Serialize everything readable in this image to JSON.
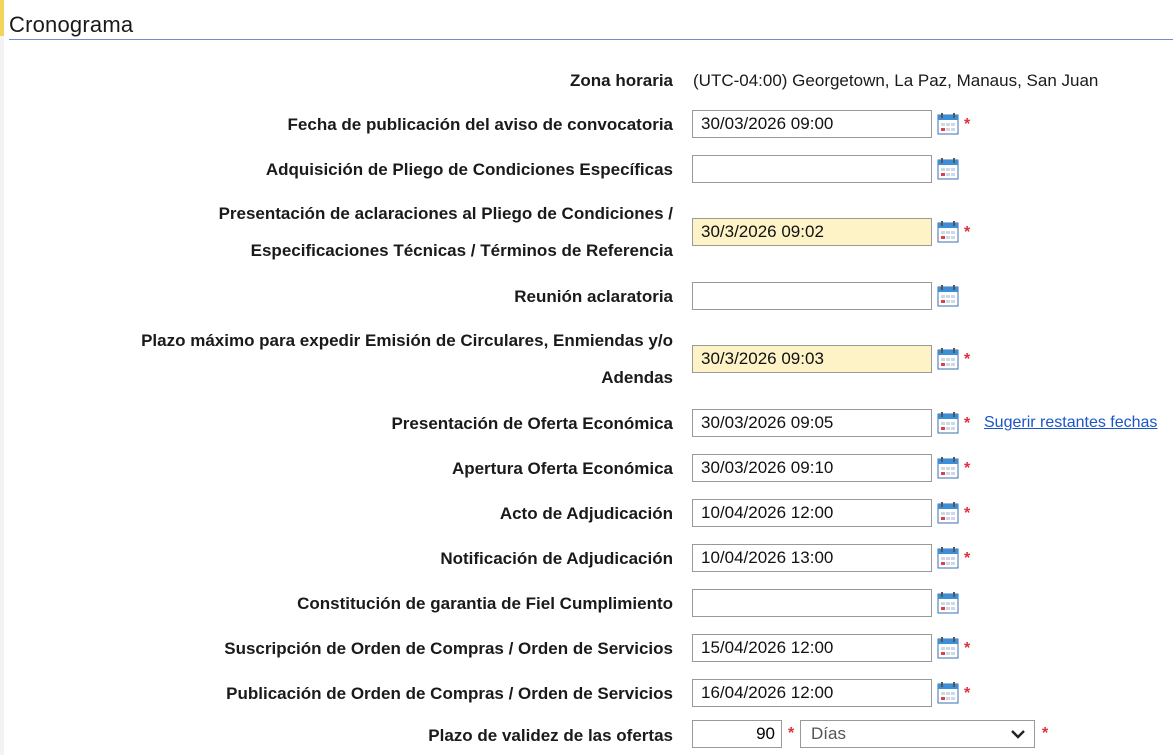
{
  "section": {
    "title": "Cronograma"
  },
  "timezone": {
    "label": "Zona horaria",
    "value": "(UTC-04:00) Georgetown, La Paz, Manaus, San Juan"
  },
  "fields": [
    {
      "label_lines": [
        "Fecha de publicación del aviso de convocatoria"
      ],
      "value": "30/03/2026 09:00",
      "required": true,
      "highlight": false
    },
    {
      "label_lines": [
        "Adquisición de Pliego de Condiciones Específicas"
      ],
      "value": "",
      "required": false,
      "highlight": false
    },
    {
      "label_lines": [
        "Presentación de aclaraciones al Pliego de Condiciones /",
        "Especificaciones Técnicas / Términos de Referencia"
      ],
      "value": "30/3/2026 09:02",
      "required": true,
      "highlight": true
    },
    {
      "label_lines": [
        "Reunión aclaratoria"
      ],
      "value": "",
      "required": false,
      "highlight": false
    },
    {
      "label_lines": [
        "Plazo máximo para expedir Emisión de Circulares, Enmiendas y/o",
        "Adendas"
      ],
      "value": "30/3/2026 09:03",
      "required": true,
      "highlight": true
    },
    {
      "label_lines": [
        "Presentación de Oferta Económica"
      ],
      "value": "30/03/2026 09:05",
      "required": true,
      "highlight": false,
      "link": "Sugerir restantes fechas"
    },
    {
      "label_lines": [
        "Apertura Oferta Económica"
      ],
      "value": "30/03/2026 09:10",
      "required": true,
      "highlight": false
    },
    {
      "label_lines": [
        "Acto de Adjudicación"
      ],
      "value": "10/04/2026 12:00",
      "required": true,
      "highlight": false
    },
    {
      "label_lines": [
        "Notificación de Adjudicación"
      ],
      "value": "10/04/2026 13:00",
      "required": true,
      "highlight": false
    },
    {
      "label_lines": [
        "Constitución de garantia de Fiel Cumplimiento"
      ],
      "value": "",
      "required": false,
      "highlight": false
    },
    {
      "label_lines": [
        "Suscripción de Orden de Compras / Orden de Servicios"
      ],
      "value": "15/04/2026 12:00",
      "required": true,
      "highlight": false
    },
    {
      "label_lines": [
        "Publicación de Orden de Compras / Orden de Servicios"
      ],
      "value": "16/04/2026 12:00",
      "required": true,
      "highlight": false
    }
  ],
  "validity": {
    "label": "Plazo de validez de las ofertas",
    "number": "90",
    "unit": "Días"
  },
  "required_marker": "*",
  "colors": {
    "highlight": "#fdf3c6",
    "required": "#e0303b",
    "link": "#1a56c9",
    "header_rule": "#6d8fd0"
  }
}
